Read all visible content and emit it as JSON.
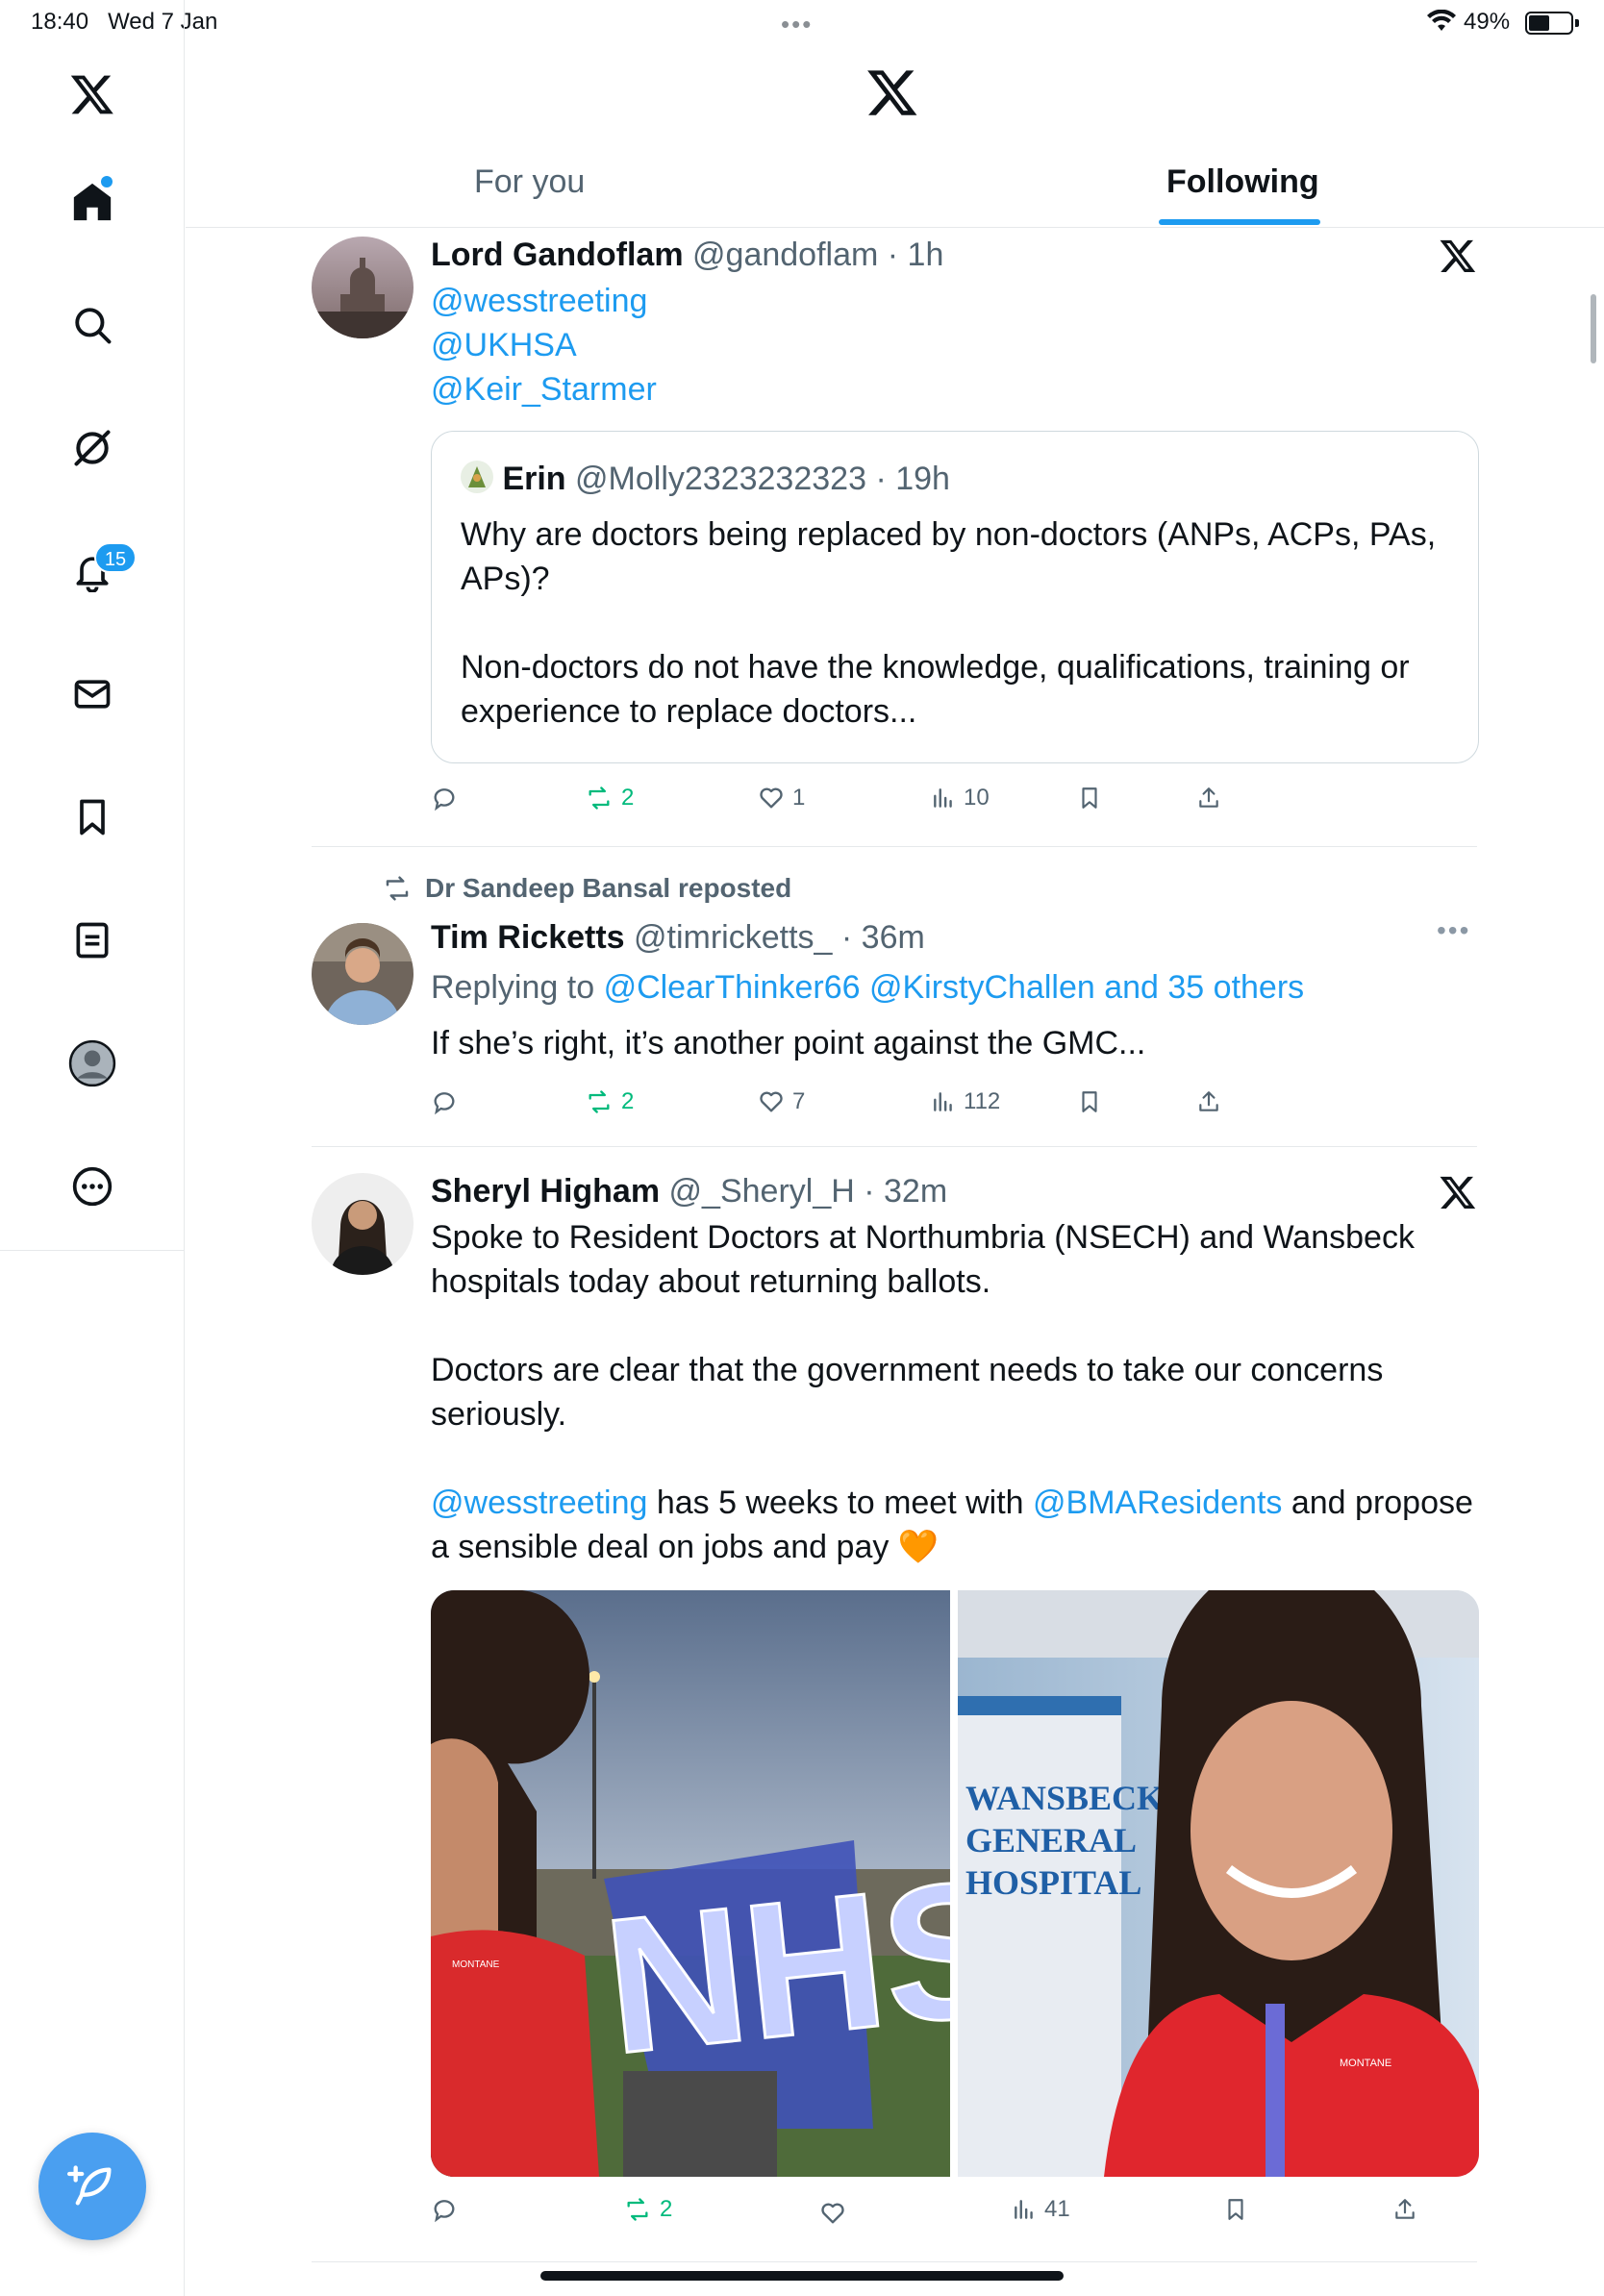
{
  "status_bar": {
    "time": "18:40",
    "date": "Wed 7 Jan",
    "battery": "49%",
    "battery_level": 0.49
  },
  "sidebar": {
    "notifications_badge": "15",
    "items": [
      "x-logo",
      "home-icon",
      "search-icon",
      "grok-icon",
      "notifications-icon",
      "messages-icon",
      "bookmarks-icon",
      "lists-icon",
      "profile-icon",
      "more-icon"
    ]
  },
  "tabs": [
    {
      "label": "For you"
    },
    {
      "label": "Following"
    }
  ],
  "posts": [
    {
      "name": "Lord Gandoflam",
      "handle": "@gandoflam",
      "time": "· 1h",
      "mentions": [
        "@wesstreeting",
        "@UKHSA",
        "@Keir_Starmer"
      ],
      "quote": {
        "name": "Erin",
        "handle": "@Molly2323232323",
        "time": "· 19h",
        "text_1": "Why are doctors being replaced by non-doctors (ANPs, ACPs, PAs, APs)?",
        "text_2": "Non-doctors do not have the knowledge, qualifications, training or experience to replace  doctors..."
      },
      "reposts": "2",
      "likes": "1",
      "views": "10"
    },
    {
      "repost_label": "Dr Sandeep Bansal reposted",
      "name": "Tim Ricketts",
      "handle": "@timricketts_",
      "time": "· 36m",
      "replying_prefix": "Replying to",
      "replying_to": "@ClearThinker66 @KirstyChallen and 35 others",
      "text": "If she’s right, it’s another point against the GMC...",
      "reposts": "2",
      "likes": "7",
      "views": "112"
    },
    {
      "name": "Sheryl Higham",
      "handle": "@_Sheryl_H",
      "time": "· 32m",
      "para_1": "Spoke to Resident Doctors at Northumbria (NSECH) and Wansbeck hospitals today about returning ballots.",
      "para_2": "Doctors are clear that the government needs to take our concerns seriously.",
      "para_3_link_1": "@wesstreeting",
      "para_3_mid": " has 5 weeks to meet with ",
      "para_3_link_2": "@BMAResidents",
      "para_3_end": " and propose a sensible deal on jobs and pay 🧡",
      "image_1_sign": "NHS",
      "image_2_sign_1": "WANSBECK",
      "image_2_sign_2": "GENERAL",
      "image_2_sign_3": "HOSPITAL",
      "jacket_brand": "MONTANE",
      "reposts": "2",
      "views": "41"
    }
  ],
  "colors": {
    "accent": "#1d9bf0",
    "repost_green": "#00ba7c",
    "text_grey": "#536471"
  }
}
